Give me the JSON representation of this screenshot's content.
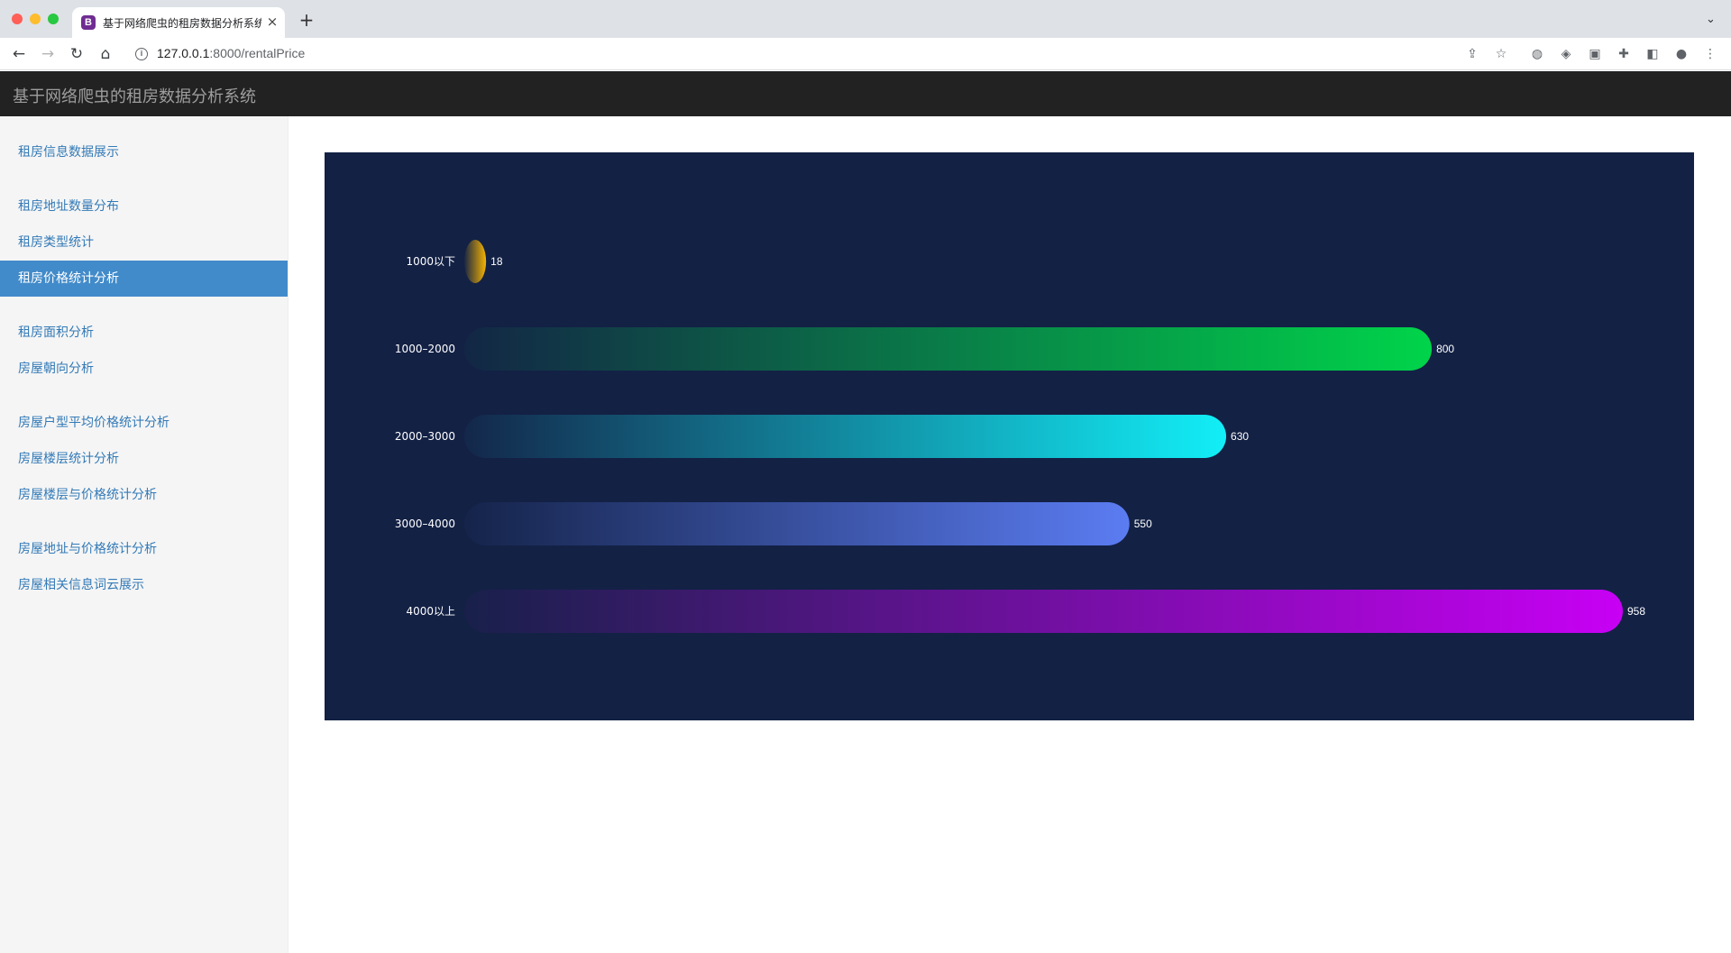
{
  "browser": {
    "tab_title": "基于网络爬虫的租房数据分析系统",
    "tab_favicon_letter": "B",
    "tab_close": "×",
    "new_tab": "+",
    "url_host": "127.0.0.1",
    "url_path": ":8000/rentalPrice"
  },
  "app": {
    "title": "基于网络爬虫的租房数据分析系统"
  },
  "sidebar": {
    "items": [
      {
        "label": "租房信息数据展示",
        "active": false
      },
      {
        "label": "租房地址数量分布",
        "active": false
      },
      {
        "label": "租房类型统计",
        "active": false
      },
      {
        "label": "租房价格统计分析",
        "active": true
      },
      {
        "label": "租房面积分析",
        "active": false
      },
      {
        "label": "房屋朝向分析",
        "active": false
      },
      {
        "label": "房屋户型平均价格统计分析",
        "active": false
      },
      {
        "label": "房屋楼层统计分析",
        "active": false
      },
      {
        "label": "房屋楼层与价格统计分析",
        "active": false
      },
      {
        "label": "房屋地址与价格统计分析",
        "active": false
      },
      {
        "label": "房屋相关信息词云展示",
        "active": false
      }
    ]
  },
  "colors": {
    "chart_background": "#132145",
    "active_nav": "#428bca",
    "link": "#337ab7",
    "header": "#222222"
  },
  "chart_data": {
    "type": "bar",
    "orientation": "horizontal",
    "categories": [
      "1000以下",
      "1000–2000",
      "2000–3000",
      "3000–4000",
      "4000以上"
    ],
    "values": [
      18,
      800,
      630,
      550,
      958
    ],
    "xlim": [
      0,
      958
    ],
    "bar_colors": [
      "#f5b301",
      "#00d44a",
      "#12eef7",
      "#5b7cf2",
      "#c800f5"
    ],
    "data_labels": true,
    "grid": false,
    "legend": "none"
  }
}
